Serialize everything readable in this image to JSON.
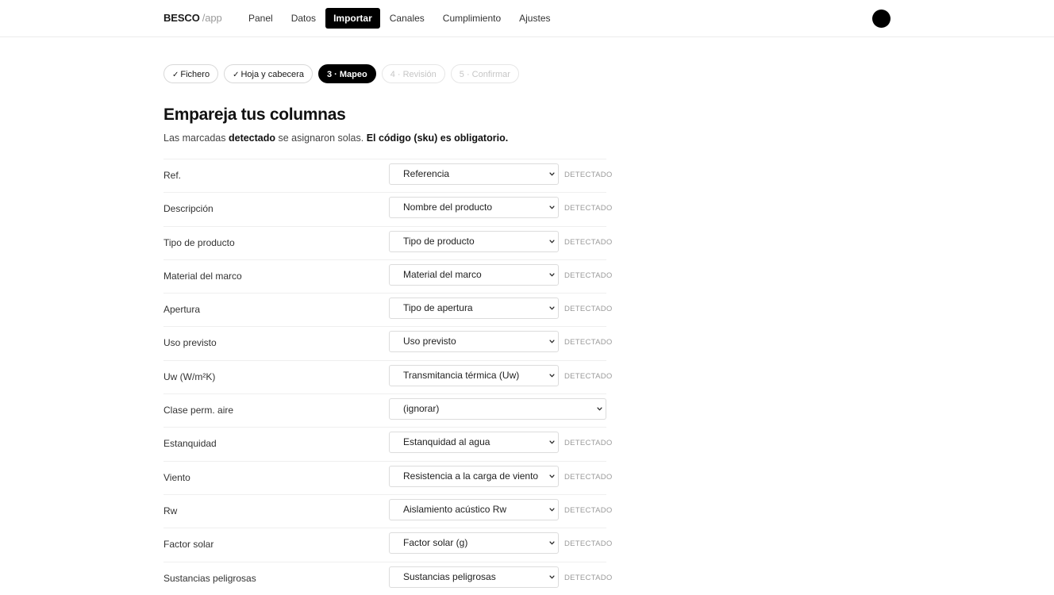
{
  "brand": {
    "name": "BESCO",
    "suffix": "/app"
  },
  "nav": {
    "items": [
      {
        "label": "Panel",
        "active": false
      },
      {
        "label": "Datos",
        "active": false
      },
      {
        "label": "Importar",
        "active": true
      },
      {
        "label": "Canales",
        "active": false
      },
      {
        "label": "Cumplimiento",
        "active": false
      },
      {
        "label": "Ajustes",
        "active": false
      }
    ]
  },
  "steps": [
    {
      "label": "Fichero",
      "state": "done"
    },
    {
      "label": "Hoja y cabecera",
      "state": "done"
    },
    {
      "label": "3 · Mapeo",
      "state": "active"
    },
    {
      "label": "4 · Revisión",
      "state": "disabled"
    },
    {
      "label": "5 · Confirmar",
      "state": "disabled"
    }
  ],
  "check_glyph": "✓",
  "main": {
    "title": "Empareja tus columnas",
    "subtitle_part1": "Las marcadas ",
    "subtitle_bold1": "detectado",
    "subtitle_part2": " se asignaron solas. ",
    "subtitle_bold2": "El código (sku) es obligatorio."
  },
  "badge_label": "DETECTADO",
  "mappings": [
    {
      "column": "Ref.",
      "value": "Referencia",
      "detected": true
    },
    {
      "column": "Descripción",
      "value": "Nombre del producto",
      "detected": true
    },
    {
      "column": "Tipo de producto",
      "value": "Tipo de producto",
      "detected": true
    },
    {
      "column": "Material del marco",
      "value": "Material del marco",
      "detected": true
    },
    {
      "column": "Apertura",
      "value": "Tipo de apertura",
      "detected": true
    },
    {
      "column": "Uso previsto",
      "value": "Uso previsto",
      "detected": true
    },
    {
      "column": "Uw (W/m²K)",
      "value": "Transmitancia térmica (Uw)",
      "detected": true
    },
    {
      "column": "Clase perm. aire",
      "value": "(ignorar)",
      "detected": false
    },
    {
      "column": "Estanquidad",
      "value": "Estanquidad al agua",
      "detected": true
    },
    {
      "column": "Viento",
      "value": "Resistencia a la carga de viento",
      "detected": true
    },
    {
      "column": "Rw",
      "value": "Aislamiento acústico Rw",
      "detected": true
    },
    {
      "column": "Factor solar",
      "value": "Factor solar (g)",
      "detected": true
    },
    {
      "column": "Sustancias peligrosas",
      "value": "Sustancias peligrosas",
      "detected": true
    }
  ]
}
